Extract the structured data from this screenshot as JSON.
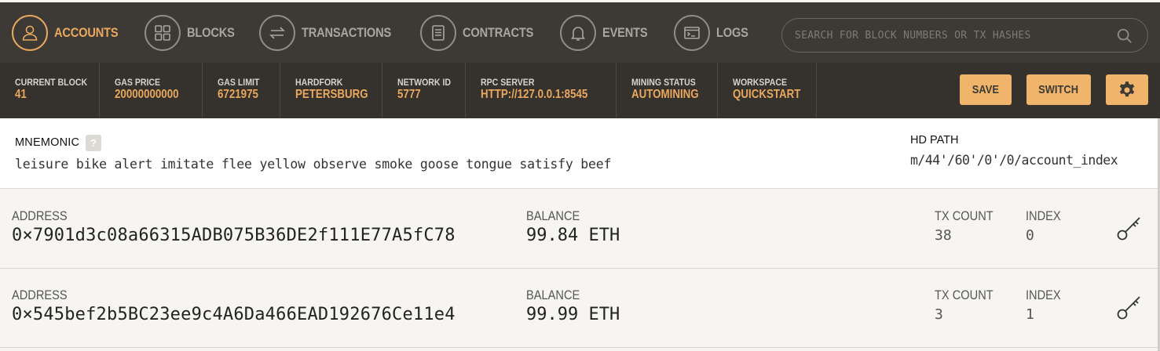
{
  "nav": {
    "items": [
      {
        "label": "ACCOUNTS",
        "icon": "user-icon",
        "active": true
      },
      {
        "label": "BLOCKS",
        "icon": "grid-icon",
        "active": false
      },
      {
        "label": "TRANSACTIONS",
        "icon": "swap-arrows-icon",
        "active": false
      },
      {
        "label": "CONTRACTS",
        "icon": "document-icon",
        "active": false
      },
      {
        "label": "EVENTS",
        "icon": "bell-icon",
        "active": false
      },
      {
        "label": "LOGS",
        "icon": "terminal-icon",
        "active": false
      }
    ],
    "search_placeholder": "SEARCH FOR BLOCK NUMBERS OR TX HASHES"
  },
  "status": {
    "current_block": {
      "label": "CURRENT BLOCK",
      "value": "41"
    },
    "gas_price": {
      "label": "GAS PRICE",
      "value": "20000000000"
    },
    "gas_limit": {
      "label": "GAS LIMIT",
      "value": "6721975"
    },
    "hardfork": {
      "label": "HARDFORK",
      "value": "PETERSBURG"
    },
    "network_id": {
      "label": "NETWORK ID",
      "value": "5777"
    },
    "rpc_server": {
      "label": "RPC SERVER",
      "value": "HTTP://127.0.0.1:8545"
    },
    "mining_status": {
      "label": "MINING STATUS",
      "value": "AUTOMINING"
    },
    "workspace": {
      "label": "WORKSPACE",
      "value": "QUICKSTART"
    }
  },
  "actions": {
    "save_label": "SAVE",
    "switch_label": "SWITCH"
  },
  "mnemonic": {
    "title": "MNEMONIC",
    "help": "?",
    "phrase": "leisure bike alert imitate flee yellow observe smoke goose tongue satisfy beef",
    "hd_path_title": "HD PATH",
    "hd_path": "m/44'/60'/0'/0/account_index"
  },
  "accounts": [
    {
      "address_label": "ADDRESS",
      "address": "0×7901d3c08a66315ADB075B36DE2f111E77A5fC78",
      "balance_label": "BALANCE",
      "balance": "99.84 ETH",
      "tx_count_label": "TX COUNT",
      "tx_count": "38",
      "index_label": "INDEX",
      "index": "0"
    },
    {
      "address_label": "ADDRESS",
      "address": "0×545bef2b5BC23ee9c4A6Da466EAD192676Ce11e4",
      "balance_label": "BALANCE",
      "balance": "99.99 ETH",
      "tx_count_label": "TX COUNT",
      "tx_count": "3",
      "index_label": "INDEX",
      "index": "1"
    }
  ],
  "colors": {
    "accent": "#e9a85e",
    "nav_bg": "#3d3a36",
    "status_bg": "#35322e",
    "button": "#f1b46b"
  }
}
